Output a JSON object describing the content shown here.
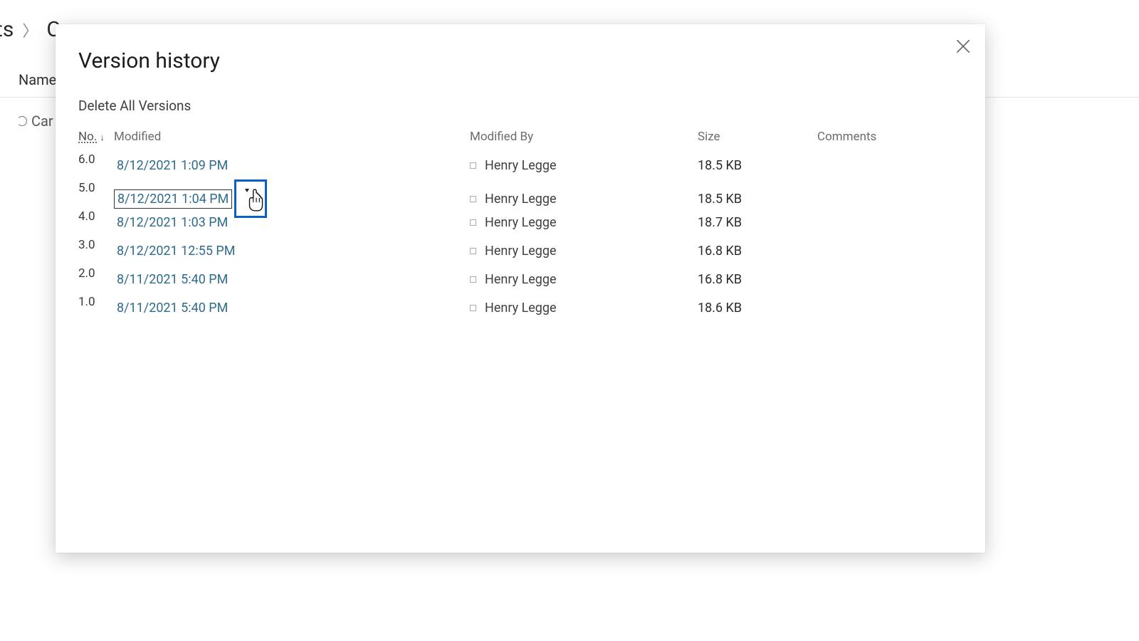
{
  "background": {
    "breadcrumb_prev_trunc": "ts",
    "breadcrumb_curr_trunc": "Ca",
    "col_name": "Name",
    "file_trunc": "Car typ"
  },
  "modal": {
    "title": "Version history",
    "delete_all": "Delete All Versions",
    "columns": {
      "no": "No.",
      "modified": "Modified",
      "modified_by": "Modified By",
      "size": "Size",
      "comments": "Comments"
    }
  },
  "versions": [
    {
      "no": "6.0",
      "modified": "8/12/2021 1:09 PM",
      "by": "Henry Legge",
      "size": "18.5 KB",
      "selected": false
    },
    {
      "no": "5.0",
      "modified": "8/12/2021 1:04 PM",
      "by": "Henry Legge",
      "size": "18.5 KB",
      "selected": true
    },
    {
      "no": "4.0",
      "modified": "8/12/2021 1:03 PM",
      "by": "Henry Legge",
      "size": "18.7 KB",
      "selected": false
    },
    {
      "no": "3.0",
      "modified": "8/12/2021 12:55 PM",
      "by": "Henry Legge",
      "size": "16.8 KB",
      "selected": false
    },
    {
      "no": "2.0",
      "modified": "8/11/2021 5:40 PM",
      "by": "Henry Legge",
      "size": "16.8 KB",
      "selected": false
    },
    {
      "no": "1.0",
      "modified": "8/11/2021 5:40 PM",
      "by": "Henry Legge",
      "size": "18.6 KB",
      "selected": false
    }
  ]
}
